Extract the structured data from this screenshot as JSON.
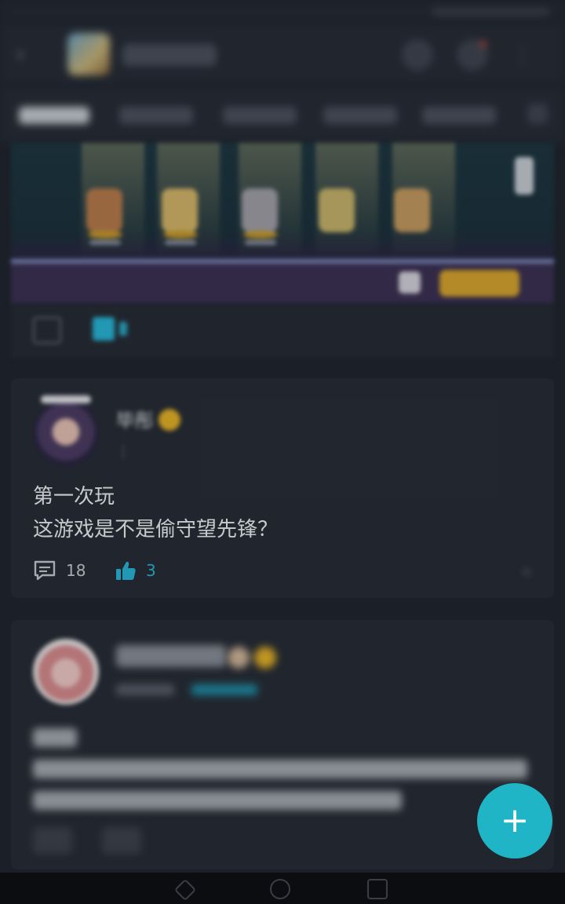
{
  "app": {
    "title_icon": "game-logo",
    "icons": [
      "back-icon",
      "search-icon",
      "message-icon",
      "more-icon"
    ]
  },
  "tabs": [
    "",
    "",
    "",
    "",
    ""
  ],
  "banner": {
    "comment_icon": "comment-icon",
    "like_icon": "thumb-up-icon"
  },
  "posts": [
    {
      "user_name": "毕彤",
      "meta_time": "",
      "meta_tag": "",
      "content": "第一次玩\n这游戏是不是偷守望先锋？",
      "comment_count": "18",
      "like_count": "3"
    },
    {
      "user_name": "",
      "meta_time": "",
      "meta_tag": "",
      "content": "",
      "comment_count": "",
      "like_count": ""
    }
  ],
  "fab": {
    "icon": "plus-icon",
    "label": "+"
  },
  "colors": {
    "background": "#1f232c",
    "card": "#262b35",
    "accent": "#28b6d8",
    "fab": "#1fb5c7",
    "gold": "#e7b327"
  }
}
